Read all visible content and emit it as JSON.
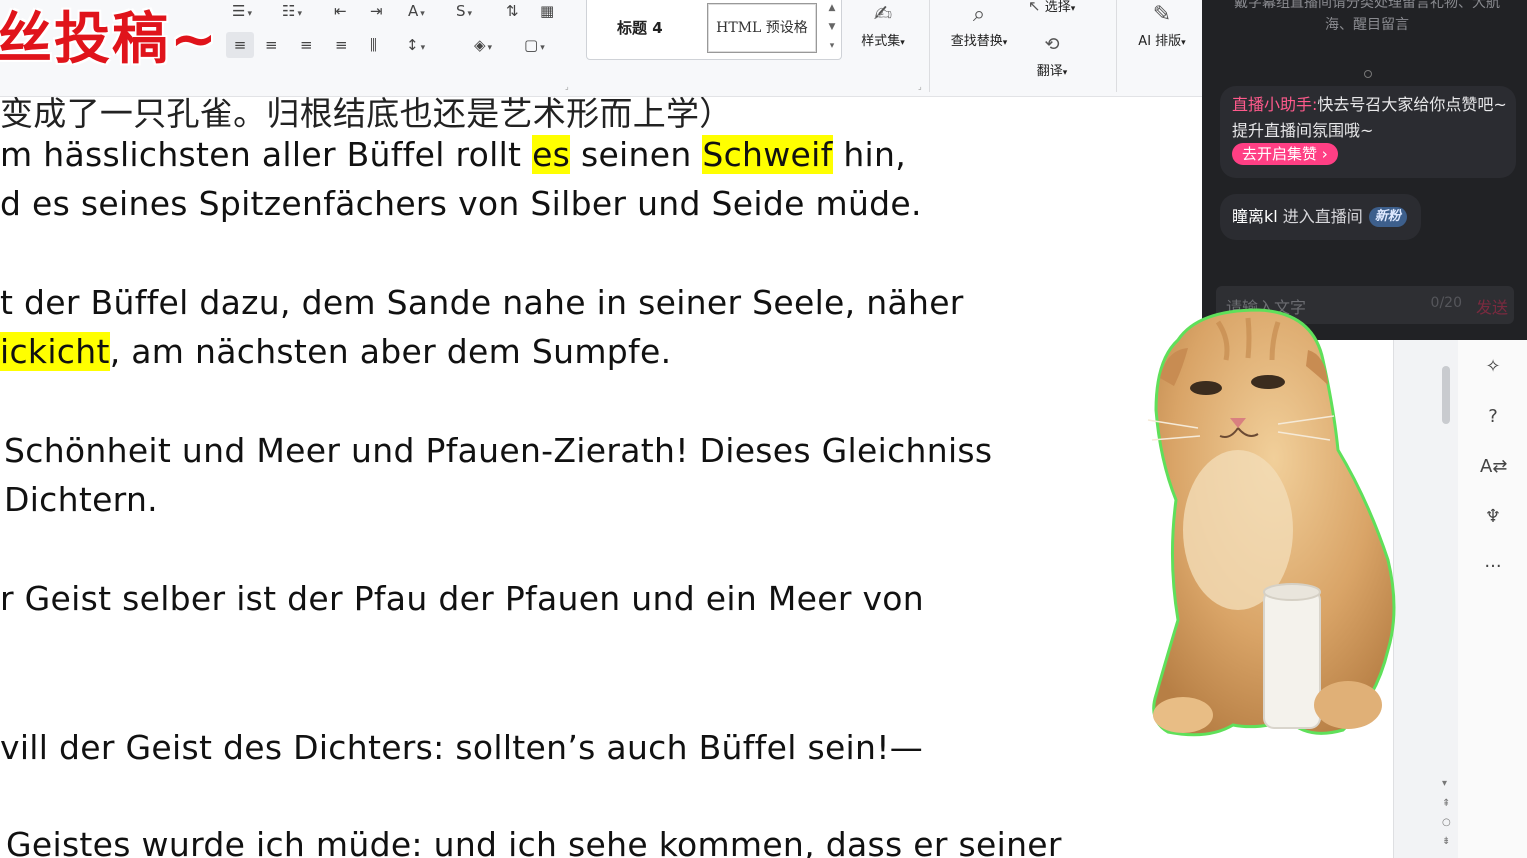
{
  "overlay": {
    "title": "丝投稿~"
  },
  "ribbon": {
    "style_heading": "标题 4",
    "style_html": "HTML 预设格",
    "style_set": "样式集",
    "find_replace": "查找替换",
    "select": "选择",
    "translate": "翻译",
    "ai_layout": "AI 排版"
  },
  "document": {
    "lines": [
      {
        "text": "变成了一只孔雀。归根结底也还是艺术形而上学）"
      },
      {
        "pre": "m hässlichsten aller Büffel rollt ",
        "h1": "es",
        "mid": " seinen ",
        "h2": "Schweif",
        "post": " hin,"
      },
      {
        "text": "d es seines Spitzenfächers von Silber und Seide müde."
      },
      {
        "text": "t der Büffel dazu, dem Sande nahe in seiner Seele, näher"
      },
      {
        "h1": "ickicht",
        "post": ", am nächsten aber dem Sumpfe."
      },
      {
        "text": "Schönheit und Meer und Pfauen-Zierath! Dieses Gleichniss"
      },
      {
        "text": "Dichtern."
      },
      {
        "text": "r Geist selber ist der Pfau der Pfauen und ein Meer von"
      },
      {
        "text": "vill der Geist des Dichters: sollten’s auch Büffel sein!—"
      },
      {
        "text": "Geistes wurde ich müde: und ich sehe kommen, dass er seiner"
      }
    ]
  },
  "live": {
    "top_text": "戴字幕组直播间请分类处理留言礼物、大航海、醒目留言",
    "assistant_name": "直播小助手:",
    "assistant_text": "快去号召大家给你点赞吧~提升直播间氛围哦~",
    "assistant_button": "去开启集赞 ›",
    "enter_user": "瞳离kl",
    "enter_text": " 进入直播间",
    "badge": "新粉",
    "input_placeholder": "请输入文字",
    "input_count": "0/20",
    "send": "发送"
  },
  "colors": {
    "highlight": "#ffff00",
    "overlay_red": "#e0141b",
    "live_bg": "#212225",
    "accent_pink": "#ff3f84"
  }
}
